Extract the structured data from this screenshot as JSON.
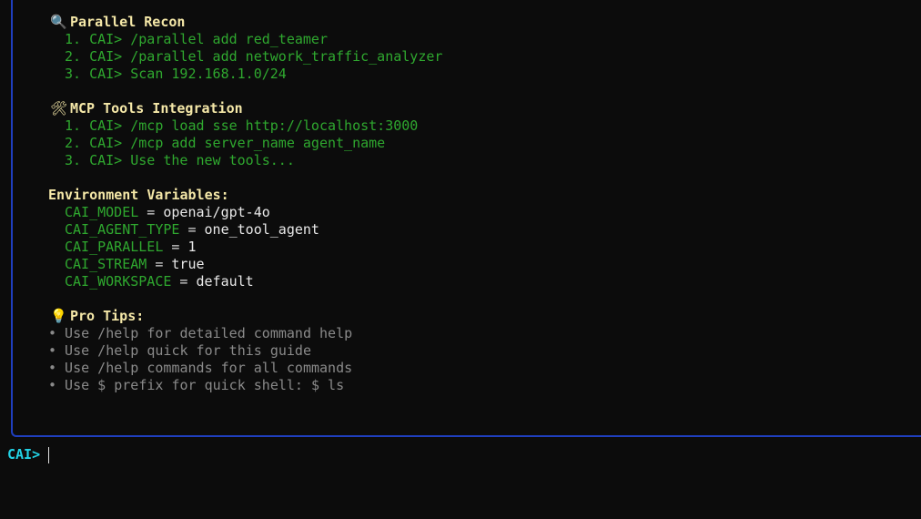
{
  "sections": {
    "parallel": {
      "icon": "magnifier-icon",
      "icon_glyph": "🔍",
      "title": "Parallel Recon",
      "steps": [
        "1. CAI> /parallel add red_teamer",
        "2. CAI> /parallel add network_traffic_analyzer",
        "3. CAI> Scan 192.168.1.0/24"
      ]
    },
    "mcp": {
      "icon": "tools-icon",
      "icon_glyph": "🛠",
      "title": "MCP Tools Integration",
      "steps": [
        "1. CAI> /mcp load sse http://localhost:3000",
        "2. CAI> /mcp add server_name agent_name",
        "3. CAI> Use the new tools..."
      ]
    },
    "env": {
      "title": "Environment Variables:",
      "vars": [
        {
          "name": "CAI_MODEL",
          "eq": " = ",
          "value": "openai/gpt-4o"
        },
        {
          "name": "CAI_AGENT_TYPE",
          "eq": " = ",
          "value": "one_tool_agent"
        },
        {
          "name": "CAI_PARALLEL",
          "eq": " = ",
          "value": "1"
        },
        {
          "name": "CAI_STREAM",
          "eq": " = ",
          "value": "true"
        },
        {
          "name": "CAI_WORKSPACE",
          "eq": " = ",
          "value": "default"
        }
      ]
    },
    "tips": {
      "icon": "lightbulb-icon",
      "icon_glyph": "💡",
      "title": "Pro Tips:",
      "items": [
        "• Use /help for detailed command help",
        "• Use /help quick for this guide",
        "• Use /help commands for all commands",
        "• Use $ prefix for quick shell: $ ls"
      ]
    }
  },
  "prompt": {
    "label": "CAI>"
  },
  "colors": {
    "heading": "#f5e8a8",
    "step": "#2fa82f",
    "tip": "#8a8a8a",
    "prompt": "#22d3e6",
    "panel_border": "#1f3fbf"
  }
}
